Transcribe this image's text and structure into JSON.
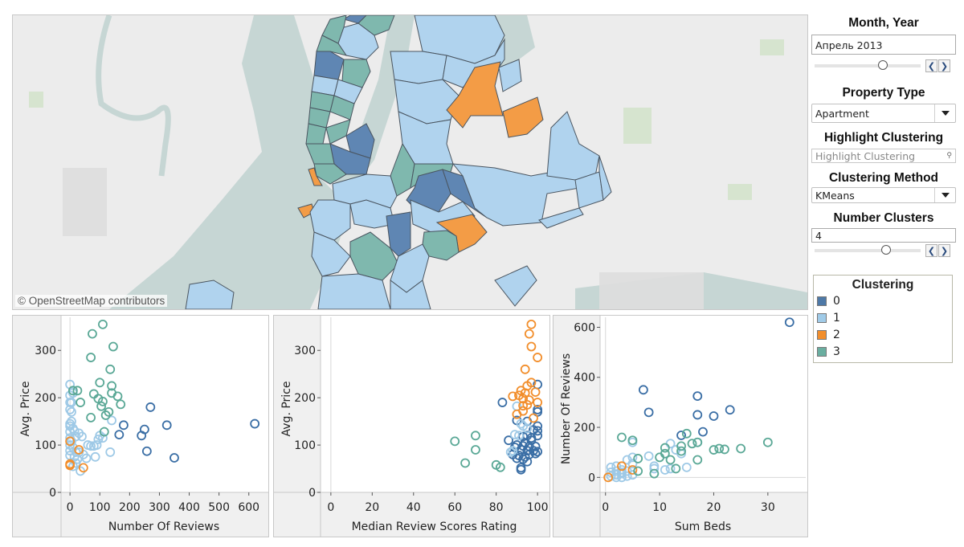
{
  "map": {
    "attribution": "© OpenStreetMap contributors",
    "regions": [
      {
        "cluster": 0
      },
      {
        "cluster": 1
      },
      {
        "cluster": 2
      },
      {
        "cluster": 3
      }
    ]
  },
  "controls": {
    "month_year": {
      "title": "Month, Year",
      "value": "Апрель 2013",
      "slider_position": 0.64
    },
    "property_type": {
      "title": "Property Type",
      "value": "Apartment"
    },
    "highlight": {
      "title": "Highlight Clustering",
      "placeholder": "Highlight Clustering"
    },
    "method": {
      "title": "Clustering Method",
      "value": "KMeans"
    },
    "num_clusters": {
      "title": "Number Clusters",
      "value": "4",
      "slider_position": 0.67
    }
  },
  "legend": {
    "title": "Clustering",
    "items": [
      {
        "label": "0",
        "color": "#4e79a7"
      },
      {
        "label": "1",
        "color": "#a0cbe8"
      },
      {
        "label": "2",
        "color": "#f28e2b"
      },
      {
        "label": "3",
        "color": "#6aaea0"
      }
    ]
  },
  "chart_data": [
    {
      "type": "scatter",
      "xlabel": "Number Of Reviews",
      "ylabel": "Avg. Price",
      "xlim": [
        -30,
        660
      ],
      "ylim": [
        0,
        370
      ],
      "xticks": [
        0,
        100,
        200,
        300,
        400,
        500,
        600
      ],
      "yticks": [
        0,
        100,
        200,
        300
      ],
      "series": [
        {
          "name": "0",
          "color": "#3a6ea5",
          "points": [
            [
              270,
              180
            ],
            [
              180,
              142
            ],
            [
              325,
              142
            ],
            [
              250,
              133
            ],
            [
              165,
              122
            ],
            [
              240,
              120
            ],
            [
              620,
              145
            ],
            [
              258,
              87
            ],
            [
              350,
              73
            ]
          ]
        },
        {
          "name": "1",
          "color": "#9ec9e6",
          "points": [
            [
              0,
              228
            ],
            [
              0,
              205
            ],
            [
              10,
              210
            ],
            [
              0,
              190
            ],
            [
              5,
              190
            ],
            [
              0,
              175
            ],
            [
              5,
              170
            ],
            [
              0,
              145
            ],
            [
              5,
              150
            ],
            [
              0,
              140
            ],
            [
              10,
              135
            ],
            [
              0,
              128
            ],
            [
              15,
              130
            ],
            [
              30,
              125
            ],
            [
              40,
              118
            ],
            [
              0,
              115
            ],
            [
              20,
              118
            ],
            [
              100,
              120
            ],
            [
              110,
              115
            ],
            [
              95,
              112
            ],
            [
              90,
              100
            ],
            [
              80,
              98
            ],
            [
              70,
              98
            ],
            [
              60,
              100
            ],
            [
              0,
              100
            ],
            [
              10,
              95
            ],
            [
              0,
              88
            ],
            [
              20,
              85
            ],
            [
              30,
              85
            ],
            [
              45,
              80
            ],
            [
              0,
              78
            ],
            [
              15,
              75
            ],
            [
              25,
              70
            ],
            [
              55,
              72
            ],
            [
              20,
              62
            ],
            [
              10,
              55
            ],
            [
              35,
              45
            ],
            [
              140,
              152
            ],
            [
              135,
              85
            ],
            [
              85,
              75
            ],
            [
              5,
              108
            ]
          ]
        },
        {
          "name": "2",
          "color": "#f28e2b",
          "points": [
            [
              0,
              108
            ],
            [
              30,
              90
            ],
            [
              0,
              60
            ],
            [
              0,
              57
            ],
            [
              45,
              52
            ]
          ]
        },
        {
          "name": "3",
          "color": "#5aa896",
          "points": [
            [
              110,
              355
            ],
            [
              75,
              335
            ],
            [
              145,
              308
            ],
            [
              70,
              285
            ],
            [
              135,
              260
            ],
            [
              100,
              232
            ],
            [
              140,
              225
            ],
            [
              25,
              215
            ],
            [
              10,
              215
            ],
            [
              80,
              208
            ],
            [
              140,
              210
            ],
            [
              95,
              198
            ],
            [
              160,
              203
            ],
            [
              110,
              192
            ],
            [
              105,
              182
            ],
            [
              170,
              186
            ],
            [
              35,
              190
            ],
            [
              130,
              170
            ],
            [
              120,
              163
            ],
            [
              70,
              158
            ],
            [
              115,
              128
            ]
          ]
        }
      ]
    },
    {
      "type": "scatter",
      "xlabel": "Median Review Scores Rating",
      "ylabel": "Avg. Price",
      "xlim": [
        -5,
        105
      ],
      "ylim": [
        0,
        370
      ],
      "xticks": [
        0,
        20,
        40,
        60,
        80,
        100
      ],
      "yticks": [
        0,
        100,
        200,
        300
      ],
      "series": [
        {
          "name": "0",
          "color": "#3a6ea5",
          "points": [
            [
              83,
              190
            ],
            [
              100,
              228
            ],
            [
              100,
              175
            ],
            [
              100,
              170
            ],
            [
              90,
              152
            ],
            [
              95,
              150
            ],
            [
              100,
              140
            ],
            [
              98,
              132
            ],
            [
              100,
              130
            ],
            [
              100,
              120
            ],
            [
              95,
              120
            ],
            [
              93,
              118
            ],
            [
              97,
              115
            ],
            [
              86,
              110
            ],
            [
              90,
              100
            ],
            [
              93,
              98
            ],
            [
              96,
              97
            ],
            [
              99,
              97
            ],
            [
              89,
              95
            ],
            [
              92,
              90
            ],
            [
              95,
              88
            ],
            [
              98,
              88
            ],
            [
              100,
              86
            ],
            [
              88,
              80
            ],
            [
              91,
              78
            ],
            [
              94,
              75
            ],
            [
              96,
              80
            ],
            [
              99,
              82
            ],
            [
              90,
              72
            ],
            [
              93,
              70
            ],
            [
              95,
              65
            ],
            [
              92,
              52
            ],
            [
              92,
              48
            ],
            [
              97,
              110
            ],
            [
              94,
              105
            ]
          ]
        },
        {
          "name": "1",
          "color": "#9ec9e6",
          "points": [
            [
              90,
              182
            ],
            [
              92,
              145
            ],
            [
              93,
              140
            ],
            [
              95,
              135
            ],
            [
              89,
              122
            ],
            [
              91,
              120
            ],
            [
              88,
              88
            ],
            [
              87,
              85
            ]
          ]
        },
        {
          "name": "2",
          "color": "#f28e2b",
          "points": [
            [
              97,
              355
            ],
            [
              96,
              335
            ],
            [
              97,
              308
            ],
            [
              100,
              285
            ],
            [
              94,
              260
            ],
            [
              97,
              232
            ],
            [
              95,
              225
            ],
            [
              92,
              215
            ],
            [
              94,
              210
            ],
            [
              88,
              203
            ],
            [
              91,
              205
            ],
            [
              99,
              212
            ],
            [
              93,
              198
            ],
            [
              96,
              195
            ],
            [
              100,
              190
            ],
            [
              95,
              185
            ],
            [
              93,
              183
            ],
            [
              90,
              165
            ],
            [
              93,
              172
            ],
            [
              98,
              157
            ]
          ]
        },
        {
          "name": "3",
          "color": "#5aa896",
          "points": [
            [
              60,
              108
            ],
            [
              70,
              120
            ],
            [
              70,
              90
            ],
            [
              65,
              62
            ],
            [
              80,
              58
            ],
            [
              82,
              53
            ]
          ]
        }
      ]
    },
    {
      "type": "scatter",
      "xlabel": "Sum Beds",
      "ylabel": "Number Of Reviews",
      "xlim": [
        -1,
        37
      ],
      "ylim": [
        -60,
        640
      ],
      "xticks": [
        0,
        10,
        20,
        30
      ],
      "yticks": [
        0,
        200,
        400,
        600
      ],
      "series": [
        {
          "name": "0",
          "color": "#3a6ea5",
          "points": [
            [
              34,
              620
            ],
            [
              7,
              350
            ],
            [
              17,
              325
            ],
            [
              8,
              260
            ],
            [
              23,
              270
            ],
            [
              17,
              250
            ],
            [
              20,
              245
            ],
            [
              18,
              182
            ],
            [
              14,
              168
            ]
          ]
        },
        {
          "name": "1",
          "color": "#9ec9e6",
          "points": [
            [
              1,
              40
            ],
            [
              2,
              45
            ],
            [
              3,
              30
            ],
            [
              4,
              70
            ],
            [
              5,
              80
            ],
            [
              5,
              55
            ],
            [
              3,
              15
            ],
            [
              2,
              10
            ],
            [
              1,
              5
            ],
            [
              4,
              25
            ],
            [
              1,
              20
            ],
            [
              2,
              25
            ],
            [
              3,
              20
            ],
            [
              4,
              5
            ],
            [
              5,
              10
            ],
            [
              8,
              85
            ],
            [
              9,
              45
            ],
            [
              9,
              35
            ],
            [
              11,
              30
            ],
            [
              12,
              35
            ],
            [
              13,
              110
            ],
            [
              14,
              95
            ],
            [
              12,
              135
            ],
            [
              15,
              40
            ],
            [
              17,
              140
            ],
            [
              5,
              140
            ],
            [
              3,
              0
            ],
            [
              2,
              0
            ]
          ]
        },
        {
          "name": "2",
          "color": "#f28e2b",
          "points": [
            [
              0.5,
              0
            ],
            [
              3,
              45
            ],
            [
              5,
              30
            ]
          ]
        },
        {
          "name": "3",
          "color": "#5aa896",
          "points": [
            [
              3,
              160
            ],
            [
              5,
              148
            ],
            [
              6,
              75
            ],
            [
              6,
              25
            ],
            [
              9,
              15
            ],
            [
              10,
              80
            ],
            [
              11,
              118
            ],
            [
              11,
              95
            ],
            [
              12,
              70
            ],
            [
              13,
              35
            ],
            [
              14,
              125
            ],
            [
              14,
              105
            ],
            [
              15,
              175
            ],
            [
              16,
              135
            ],
            [
              17,
              140
            ],
            [
              17,
              70
            ],
            [
              20,
              110
            ],
            [
              21,
              115
            ],
            [
              22,
              112
            ],
            [
              25,
              115
            ],
            [
              30,
              140
            ]
          ]
        }
      ]
    }
  ]
}
